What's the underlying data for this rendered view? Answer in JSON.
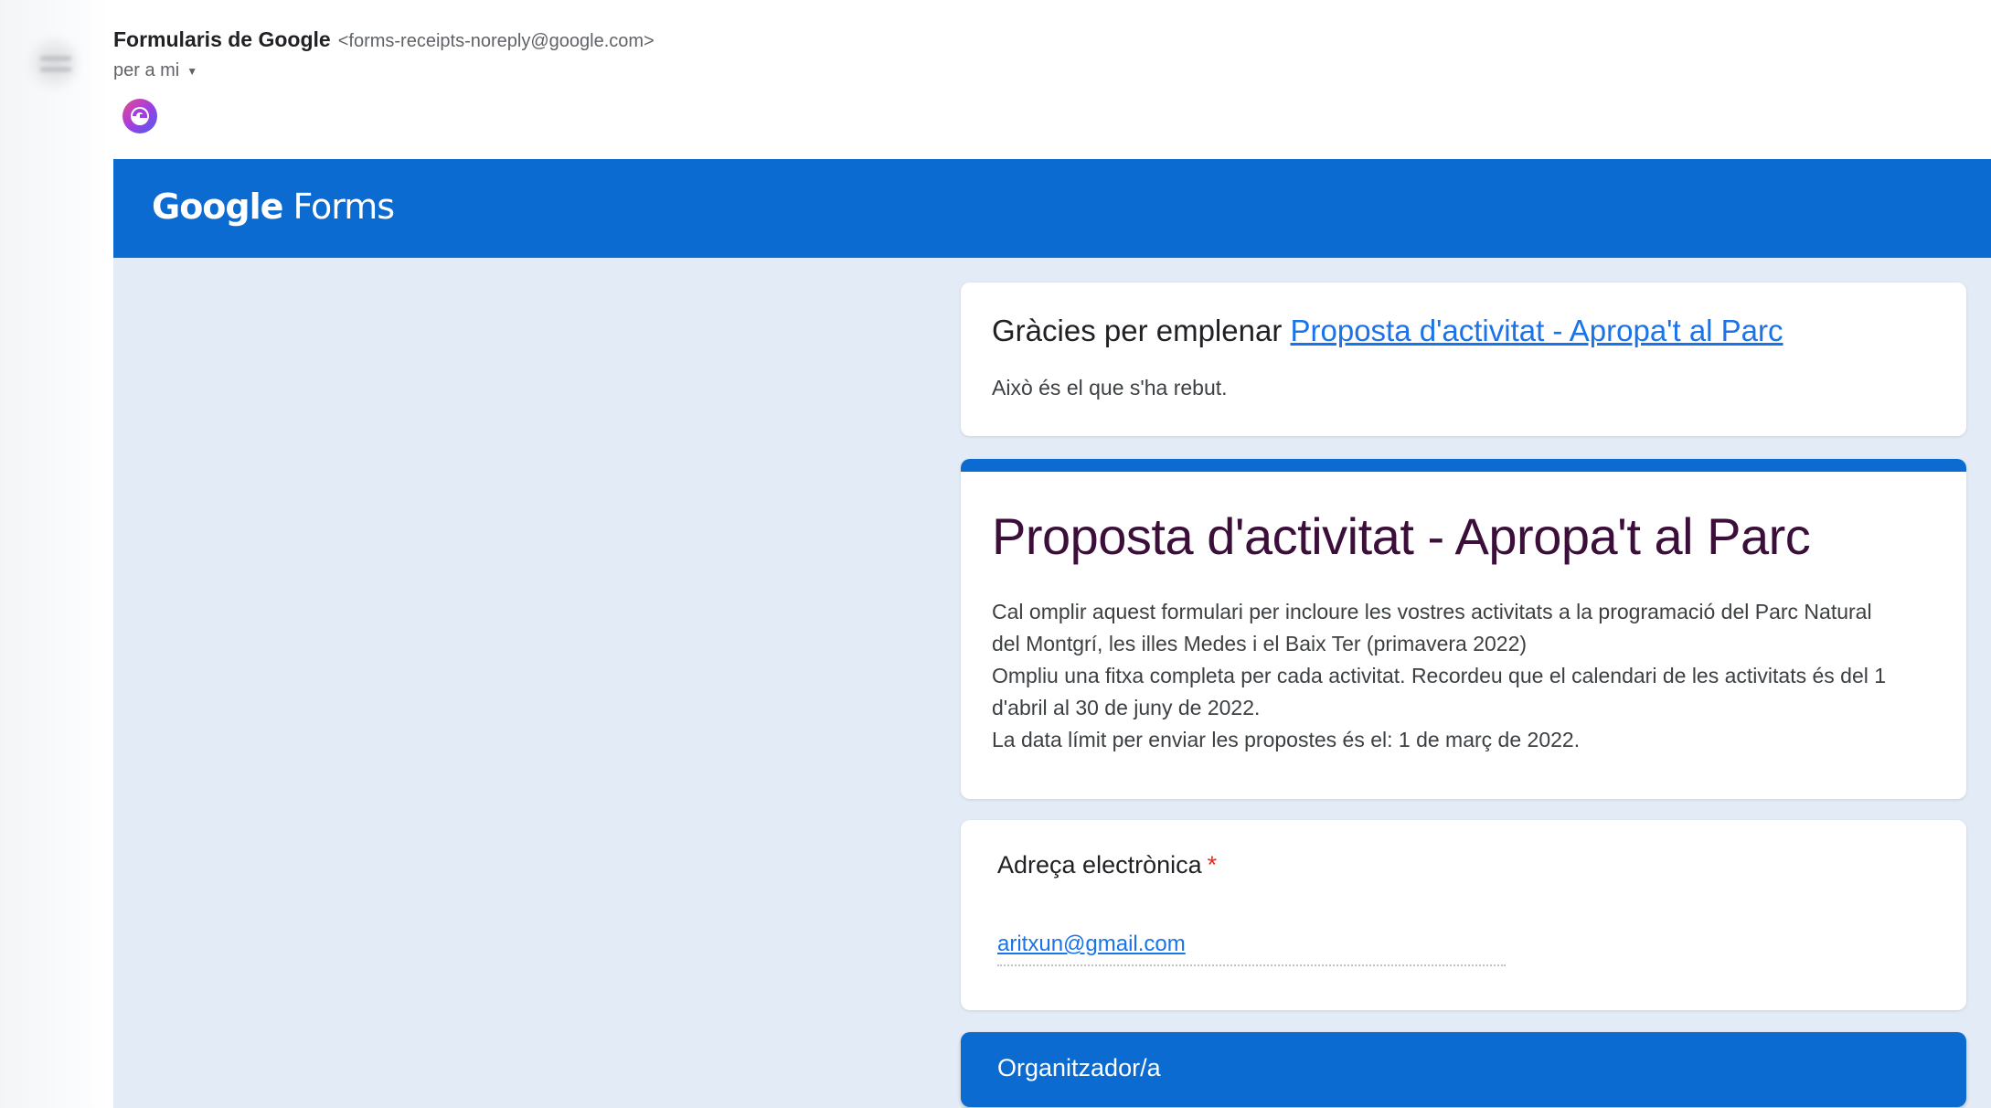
{
  "email": {
    "sender_name": "Formularis de Google",
    "sender_address": "<forms-receipts-noreply@google.com>",
    "recipient": "per a mi"
  },
  "banner": {
    "logo_google": "Google",
    "logo_forms": "Forms",
    "color": "#0c6bd0"
  },
  "thanks_card": {
    "prefix": "Gràcies per emplenar",
    "form_link": "Proposta d'activitat - Apropa't al Parc",
    "received": "Això és el que s'ha rebut."
  },
  "form_card": {
    "title": "Proposta d'activitat - Apropa't al Parc",
    "description_lines": [
      "Cal omplir aquest formulari per incloure les vostres activitats a la programació del Parc Natural",
      "del Montgrí, les illes Medes i el Baix Ter  (primavera 2022)",
      "Ompliu una fitxa completa per cada activitat. Recordeu que el calendari de les activitats és del 1",
      "d'abril al 30 de juny de 2022.",
      "La data límit per enviar les propostes és el: 1 de març de 2022."
    ]
  },
  "email_field": {
    "label": "Adreça electrònica",
    "required_mark": "*",
    "value": "aritxun@gmail.com"
  },
  "section": {
    "label": "Organitzador/a"
  },
  "icons": {
    "sender_avatar": "blurred-avatar-icon",
    "extension": "streak-extension-icon",
    "caret": "caret-down-icon"
  }
}
